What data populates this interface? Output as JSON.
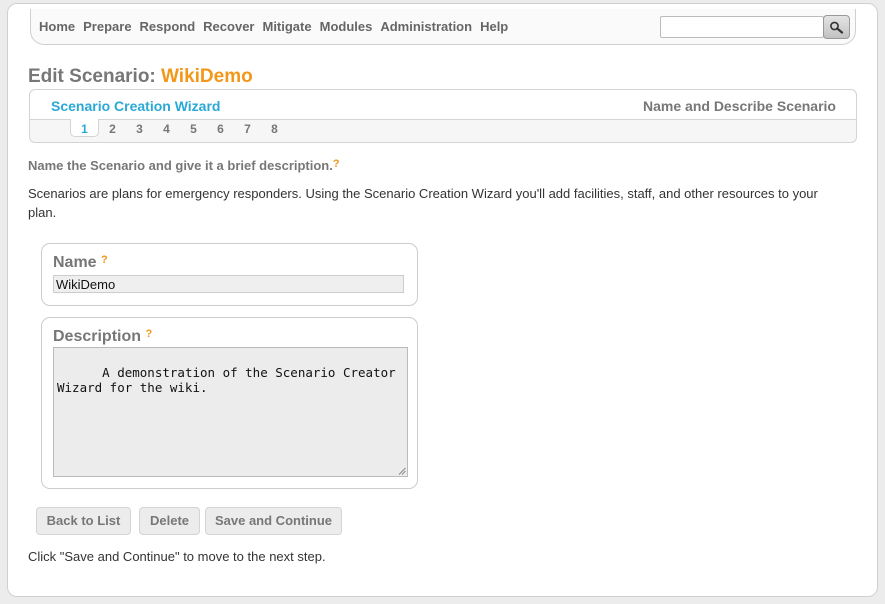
{
  "nav": {
    "items": [
      "Home",
      "Prepare",
      "Respond",
      "Recover",
      "Mitigate",
      "Modules",
      "Administration",
      "Help"
    ],
    "search_value": ""
  },
  "page": {
    "title_prefix": "Edit Scenario:",
    "title_name": "WikiDemo"
  },
  "wizard": {
    "name": "Scenario Creation Wizard",
    "step_title": "Name and Describe Scenario",
    "steps": [
      "1",
      "2",
      "3",
      "4",
      "5",
      "6",
      "7",
      "8"
    ],
    "active_step": "1"
  },
  "intro": {
    "heading": "Name the Scenario and give it a brief description.",
    "help": "?",
    "text": "Scenarios are plans for emergency responders. Using the Scenario Creation Wizard you'll add facilities, staff, and other resources to your plan."
  },
  "form": {
    "name_label": "Name",
    "name_value": "WikiDemo",
    "description_label": "Description",
    "description_value": "A demonstration of the Scenario Creator\nWizard for the wiki.",
    "help": "?"
  },
  "buttons": {
    "back": "Back to List",
    "delete": "Delete",
    "save": "Save and Continue"
  },
  "footer": {
    "note": "Click \"Save and Continue\" to move to the next step."
  },
  "colors": {
    "accent_orange": "#f29718",
    "accent_blue": "#2aa9d6"
  }
}
